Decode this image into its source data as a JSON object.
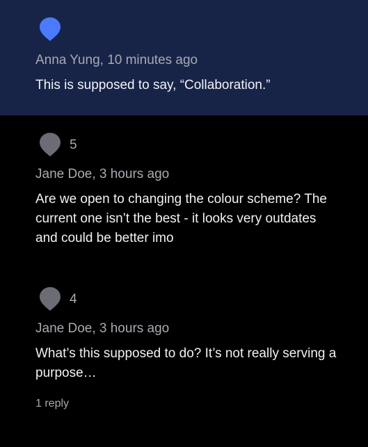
{
  "colors": {
    "active_background": "#172448",
    "page_background": "#000000",
    "active_pin": "#4a7bff",
    "inactive_pin": "#6c6c74",
    "meta_text": "#a9a9b2",
    "body_text": "#f2f2f5"
  },
  "comments": [
    {
      "author_time": "Anna Yung, 10 minutes ago",
      "text": "This is supposed to say, “Collaboration.”",
      "count": "",
      "pin_icon": "location-pin-icon",
      "active": true
    },
    {
      "author_time": "Jane Doe, 3 hours ago",
      "text": "Are we open to changing the colour scheme? The current one isn’t the best - it looks very outdates and could be better imo",
      "count": "5",
      "pin_icon": "location-pin-icon",
      "active": false
    },
    {
      "author_time": "Jane Doe, 3 hours ago",
      "text": "What’s this supposed to do? It’s not really serving a purpose…",
      "count": "4",
      "pin_icon": "location-pin-icon",
      "active": false,
      "reply_label": "1 reply"
    }
  ]
}
